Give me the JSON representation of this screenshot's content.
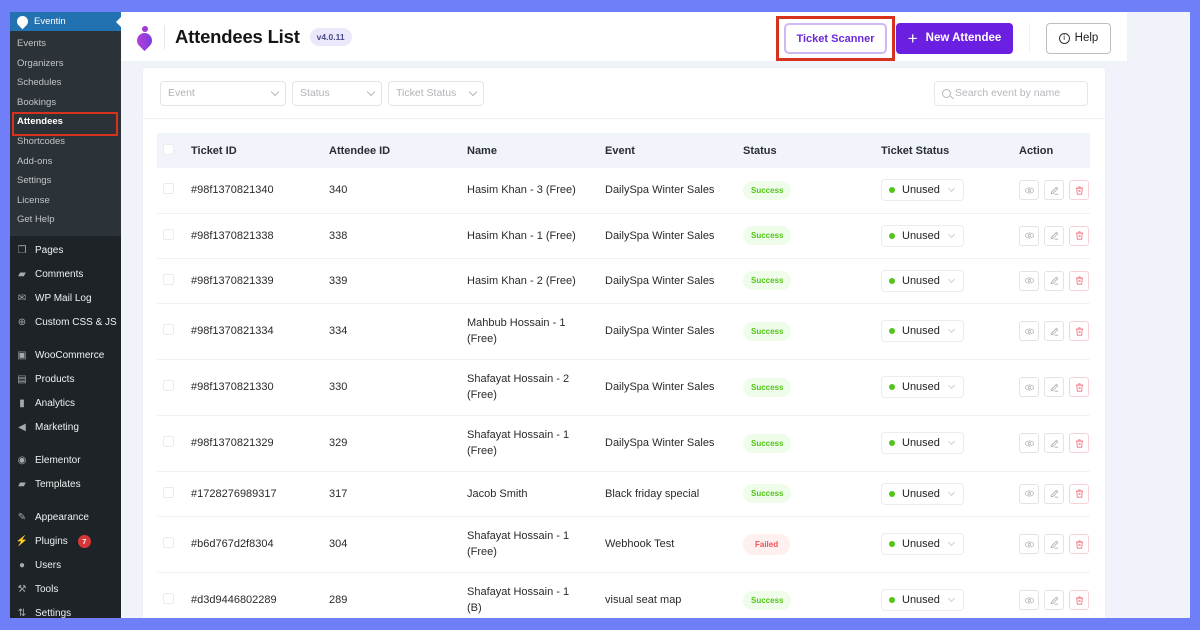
{
  "sidebar": {
    "plugin_title": "Eventin",
    "submenu": [
      {
        "label": "Events",
        "active": false
      },
      {
        "label": "Organizers",
        "active": false
      },
      {
        "label": "Schedules",
        "active": false
      },
      {
        "label": "Bookings",
        "active": false
      },
      {
        "label": "Attendees",
        "active": true
      },
      {
        "label": "Shortcodes",
        "active": false
      },
      {
        "label": "Add-ons",
        "active": false
      },
      {
        "label": "Settings",
        "active": false
      },
      {
        "label": "License",
        "active": false
      },
      {
        "label": "Get Help",
        "active": false
      }
    ],
    "groups": [
      [
        {
          "label": "Pages",
          "icon": "pages-icon",
          "glyph": "❐"
        },
        {
          "label": "Comments",
          "icon": "comments-icon",
          "glyph": "▰"
        },
        {
          "label": "WP Mail Log",
          "icon": "mail-icon",
          "glyph": "✉"
        },
        {
          "label": "Custom CSS & JS",
          "icon": "plus-circle-icon",
          "glyph": "⊕"
        }
      ],
      [
        {
          "label": "WooCommerce",
          "icon": "woocommerce-icon",
          "glyph": "▣"
        },
        {
          "label": "Products",
          "icon": "products-icon",
          "glyph": "▤"
        },
        {
          "label": "Analytics",
          "icon": "analytics-icon",
          "glyph": "▮"
        },
        {
          "label": "Marketing",
          "icon": "megaphone-icon",
          "glyph": "◀"
        }
      ],
      [
        {
          "label": "Elementor",
          "icon": "elementor-icon",
          "glyph": "◉"
        },
        {
          "label": "Templates",
          "icon": "folder-icon",
          "glyph": "▰"
        }
      ],
      [
        {
          "label": "Appearance",
          "icon": "paintbrush-icon",
          "glyph": "✎"
        },
        {
          "label": "Plugins",
          "icon": "plugin-icon",
          "glyph": "⚡",
          "badge": "7"
        },
        {
          "label": "Users",
          "icon": "user-icon",
          "glyph": "●"
        },
        {
          "label": "Tools",
          "icon": "wrench-icon",
          "glyph": "⚒"
        },
        {
          "label": "Settings",
          "icon": "settings-icon",
          "glyph": "⇅"
        }
      ]
    ]
  },
  "header": {
    "title": "Attendees List",
    "version": "v4.0.11",
    "ticket_scanner_label": "Ticket Scanner",
    "new_attendee_label": "New Attendee",
    "help_label": "Help"
  },
  "filters": {
    "event_placeholder": "Event",
    "status_placeholder": "Status",
    "ticket_status_placeholder": "Ticket Status",
    "search_placeholder": "Search event by name"
  },
  "table": {
    "columns": [
      "Ticket ID",
      "Attendee ID",
      "Name",
      "Event",
      "Status",
      "Ticket Status",
      "Action"
    ],
    "rows": [
      {
        "ticket_id": "#98f1370821340",
        "attendee_id": "340",
        "name": "Hasim Khan - 3 (Free)",
        "event": "DailySpa Winter Sales",
        "status": "Success",
        "ticket_status": "Unused"
      },
      {
        "ticket_id": "#98f1370821338",
        "attendee_id": "338",
        "name": "Hasim Khan - 1 (Free)",
        "event": "DailySpa Winter Sales",
        "status": "Success",
        "ticket_status": "Unused"
      },
      {
        "ticket_id": "#98f1370821339",
        "attendee_id": "339",
        "name": "Hasim Khan - 2 (Free)",
        "event": "DailySpa Winter Sales",
        "status": "Success",
        "ticket_status": "Unused"
      },
      {
        "ticket_id": "#98f1370821334",
        "attendee_id": "334",
        "name": "Mahbub Hossain - 1 (Free)",
        "event": "DailySpa Winter Sales",
        "status": "Success",
        "ticket_status": "Unused"
      },
      {
        "ticket_id": "#98f1370821330",
        "attendee_id": "330",
        "name": "Shafayat Hossain - 2 (Free)",
        "event": "DailySpa Winter Sales",
        "status": "Success",
        "ticket_status": "Unused"
      },
      {
        "ticket_id": "#98f1370821329",
        "attendee_id": "329",
        "name": "Shafayat Hossain - 1 (Free)",
        "event": "DailySpa Winter Sales",
        "status": "Success",
        "ticket_status": "Unused"
      },
      {
        "ticket_id": "#1728276989317",
        "attendee_id": "317",
        "name": "Jacob Smith",
        "event": "Black friday special",
        "status": "Success",
        "ticket_status": "Unused"
      },
      {
        "ticket_id": "#b6d767d2f8304",
        "attendee_id": "304",
        "name": "Shafayat Hossain - 1 (Free)",
        "event": "Webhook Test",
        "status": "Failed",
        "ticket_status": "Unused"
      },
      {
        "ticket_id": "#d3d9446802289",
        "attendee_id": "289",
        "name": "Shafayat Hossain - 1 (B)",
        "event": "visual seat map",
        "status": "Success",
        "ticket_status": "Unused"
      }
    ]
  },
  "colors": {
    "brand_purple": "#6b1fe0",
    "success_green": "#52c41a",
    "failed_red": "#f0505a",
    "highlight_red": "#d7321e",
    "wp_sidebar": "#1d2327",
    "wp_blue": "#2271b1"
  }
}
